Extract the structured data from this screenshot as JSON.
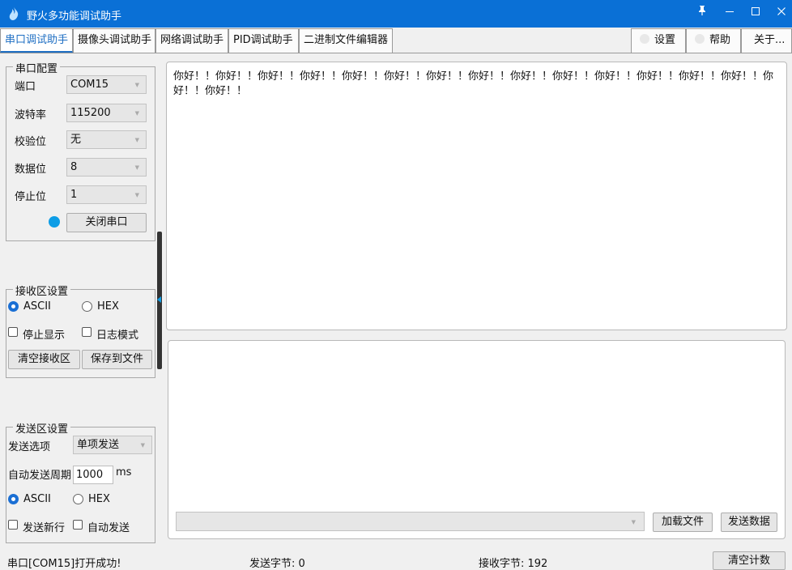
{
  "window": {
    "title": "野火多功能调试助手",
    "controls": {
      "pin": "📌",
      "minimize": "—",
      "maximize": "☐",
      "close": "✕"
    }
  },
  "tabs": [
    {
      "label": "串口调试助手",
      "active": true
    },
    {
      "label": "摄像头调试助手",
      "active": false
    },
    {
      "label": "网络调试助手",
      "active": false
    },
    {
      "label": "PID调试助手",
      "active": false
    },
    {
      "label": "二进制文件编辑器",
      "active": false
    }
  ],
  "toolbar": {
    "settings": "设置",
    "help": "帮助",
    "about": "关于..."
  },
  "serial_config": {
    "title": "串口配置",
    "port_label": "端口",
    "port_value": "COM15",
    "baud_label": "波特率",
    "baud_value": "115200",
    "parity_label": "校验位",
    "parity_value": "无",
    "databits_label": "数据位",
    "databits_value": "8",
    "stopbits_label": "停止位",
    "stopbits_value": "1",
    "toggle_button": "关闭串口",
    "status_color": "#0d9de6"
  },
  "receive_settings": {
    "title": "接收区设置",
    "ascii": "ASCII",
    "hex": "HEX",
    "mode_selected": "ASCII",
    "stop_display": "停止显示",
    "log_mode": "日志模式",
    "clear_button": "清空接收区",
    "save_button": "保存到文件"
  },
  "send_settings": {
    "title": "发送区设置",
    "option_label": "发送选项",
    "option_value": "单项发送",
    "period_label": "自动发送周期",
    "period_value": "1000",
    "period_unit": "ms",
    "ascii": "ASCII",
    "hex": "HEX",
    "mode_selected": "ASCII",
    "newline": "发送新行",
    "auto_send": "自动发送"
  },
  "receive_area": {
    "text": "你好！！你好！！你好！！你好！！你好！！你好！！你好！！你好！！你好！！你好！！你好！！你好！！你好！！你好！！你好！！你好！！"
  },
  "send_area": {
    "load_file": "加载文件",
    "send_data": "发送数据"
  },
  "statusbar": {
    "message": "串口[COM15]打开成功!",
    "sent": "发送字节: 0",
    "received": "接收字节: 192",
    "clear_count": "清空计数"
  },
  "colors": {
    "titlebar": "#0a70d6",
    "active_tab": "#1f6fc3",
    "radio_selected": "#1a6fd4"
  }
}
